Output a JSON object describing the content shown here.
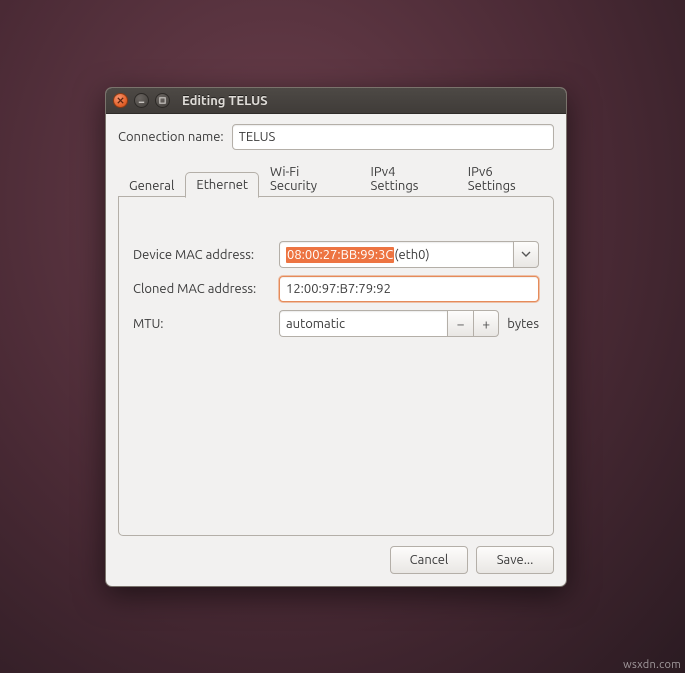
{
  "window": {
    "title": "Editing TELUS"
  },
  "form": {
    "connection_name_label": "Connection name:",
    "connection_name_value": "TELUS"
  },
  "tabs": [
    {
      "label": "General"
    },
    {
      "label": "Ethernet"
    },
    {
      "label": "Wi-Fi Security"
    },
    {
      "label": "IPv4 Settings"
    },
    {
      "label": "IPv6 Settings"
    }
  ],
  "active_tab_index": 1,
  "ethernet": {
    "device_mac_label": "Device MAC address:",
    "device_mac_selected": "08:00:27:BB:99:3C",
    "device_mac_iface": " (eth0)",
    "cloned_mac_label": "Cloned MAC address:",
    "cloned_mac_value": "12:00:97:B7:79:92",
    "mtu_label": "MTU:",
    "mtu_value": "automatic",
    "mtu_unit": "bytes"
  },
  "buttons": {
    "cancel": "Cancel",
    "save": "Save..."
  },
  "watermark": "wsxdn.com"
}
